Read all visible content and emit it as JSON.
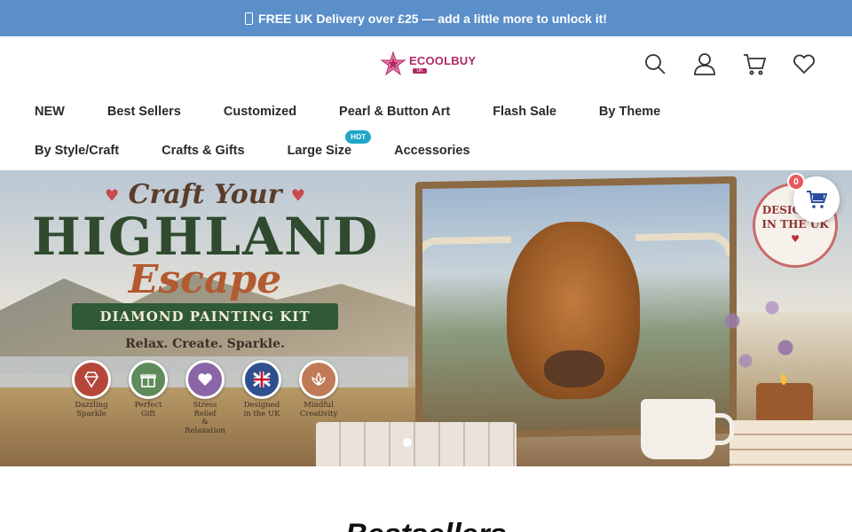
{
  "announcement": {
    "text": "FREE UK Delivery over £25 — add a little more to unlock it!",
    "icon": "gift-icon"
  },
  "header": {
    "logo_text": "ECOOLBUY",
    "logo_sub": "UK",
    "icons": [
      "search-icon",
      "account-icon",
      "cart-icon",
      "wishlist-icon"
    ]
  },
  "nav": {
    "row1": [
      "NEW",
      "Best Sellers",
      "Customized",
      "Pearl & Button Art",
      "Flash Sale",
      "By Theme"
    ],
    "row2": [
      "By Style/Craft",
      "Crafts & Gifts",
      "Large Size",
      "Accessories"
    ],
    "hot_badge": "HOT"
  },
  "hero": {
    "craft": "Craft Your",
    "title": "HIGHLAND",
    "subtitle": "Escape",
    "ribbon": "DIAMOND PAINTING KIT",
    "tagline": "Relax. Create. Sparkle.",
    "badges": [
      {
        "label1": "Dazzling",
        "label2": "Sparkle",
        "icon": "diamond-icon",
        "color": "#b5473a"
      },
      {
        "label1": "Perfect",
        "label2": "Gift",
        "icon": "gift-box-icon",
        "color": "#5f8a5a"
      },
      {
        "label1": "Stress Relief",
        "label2": "& Relaxation",
        "icon": "heart-icon",
        "color": "#8a66a8"
      },
      {
        "label1": "Designed",
        "label2": "in the UK",
        "icon": "union-jack-icon",
        "color": "#2f4f8e"
      },
      {
        "label1": "Mindful",
        "label2": "Creativity",
        "icon": "lotus-icon",
        "color": "#c07a58"
      }
    ],
    "stamp_line1": "DESIGNED",
    "stamp_line2": "IN THE UK",
    "slide_dots": 1
  },
  "floating_cart": {
    "count": "0"
  },
  "section": {
    "title": "Bestsellers"
  },
  "colors": {
    "announce_bg": "#5b8fc9",
    "hot": "#1fa7c9",
    "brand": "#b02a65"
  }
}
